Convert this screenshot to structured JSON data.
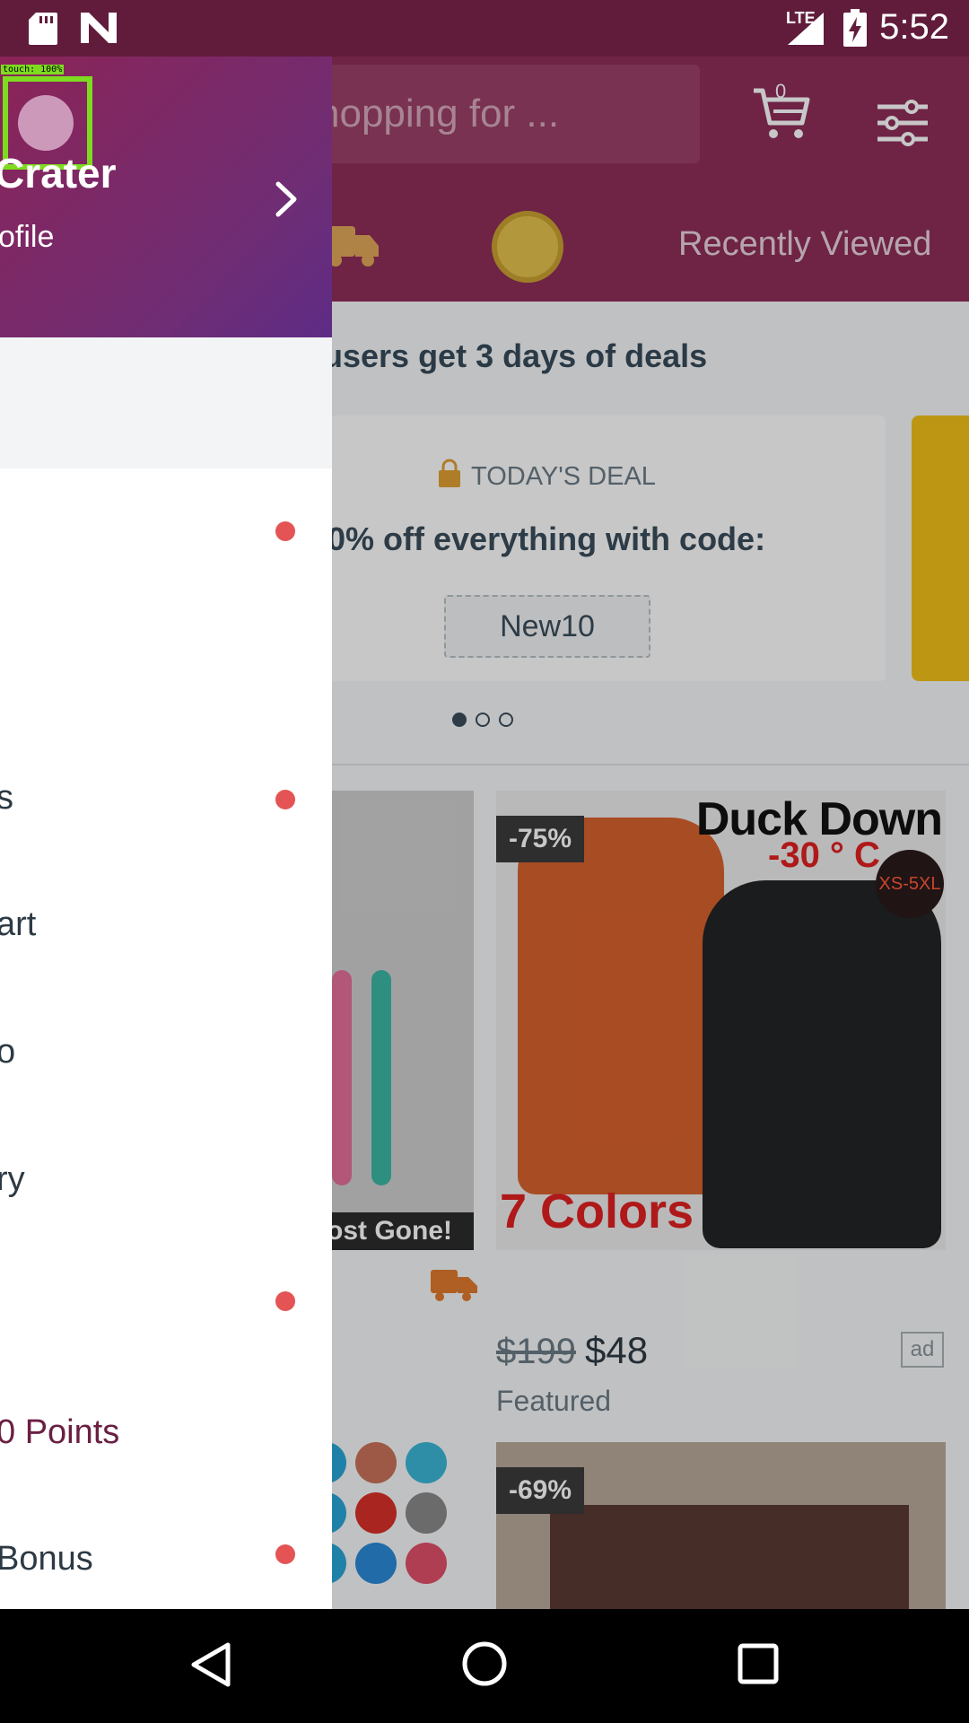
{
  "status_bar": {
    "time": "5:52",
    "network": "LTE",
    "icons": [
      "sd-card-icon",
      "n-logo-icon",
      "lte-signal-icon",
      "battery-charging-icon"
    ]
  },
  "app": {
    "search_placeholder": "hopping for ...",
    "cart_count": "0",
    "recently_viewed": "Recently Viewed",
    "promo_line": "users get 3 days of deals",
    "deal": {
      "eyebrow": "TODAY'S DEAL",
      "title": "0% off everything with code:",
      "code": "New10"
    },
    "carousel_pages": 3,
    "carousel_active": 0,
    "products": [
      {
        "badge": "ost Gone!"
      },
      {
        "discount": "-75%",
        "image_title": "Duck Down",
        "image_temp": "-30 ° C",
        "image_sizes": "XS-5XL",
        "image_colors": "7 Colors",
        "old_price": "$199",
        "price": "$48",
        "ad": "ad",
        "tag": "Featured"
      },
      {
        "discount": "-69%"
      }
    ]
  },
  "drawer": {
    "touch_label": "touch: 100%",
    "user_name": "Crater",
    "profile_link": "ofile",
    "items": [
      {
        "label": "",
        "dot": true
      },
      {
        "label": "s",
        "dot": true
      },
      {
        "label": "art",
        "dot": false
      },
      {
        "label": "o",
        "dot": false
      },
      {
        "label": "ry",
        "dot": false
      },
      {
        "label": "",
        "dot": true
      },
      {
        "label": "0 Points",
        "dot": false,
        "accent": true
      },
      {
        "label": "Bonus",
        "dot": true
      }
    ]
  },
  "colors": {
    "status_bar": "#611c3c",
    "app_bar": "#8f2d59",
    "drawer_header_start": "#8b2457",
    "drawer_header_end": "#5e2c86",
    "notification_dot": "#e45454",
    "touch_indicator": "#7ddc1f"
  },
  "nav_bar": {
    "icons": [
      "back-icon",
      "home-icon",
      "recents-icon"
    ]
  }
}
